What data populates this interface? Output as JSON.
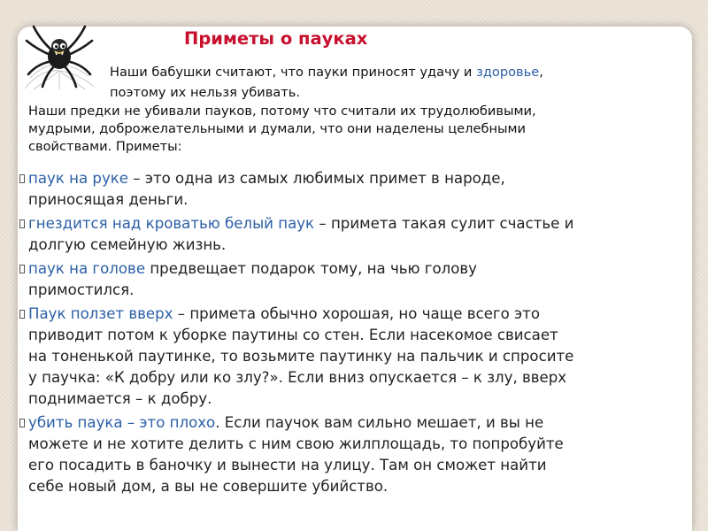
{
  "slide": {
    "title": "Приметы о пауках",
    "intro_lines": [
      {
        "plain": "Наши бабушки считают, что пауки приносят удачу и ",
        "highlight": "здоровье",
        "rest": ","
      },
      {
        "plain": "поэтому их нельзя убивать."
      }
    ],
    "paragraph_lines": [
      "Наши предки не убивали пауков, потому что считали их трудолюбивыми,",
      "мудрыми, доброжелательными и думали, что они наделены целебными",
      "свойствами. Приметы:"
    ],
    "bullets": [
      {
        "lines": [
          {
            "highlight": "паук на руке",
            "rest": " – это одна из самых любимых примет в народе,"
          },
          {
            "rest": "приносящая деньги."
          }
        ]
      },
      {
        "lines": [
          {
            "highlight": "гнездится над кроватью белый паук",
            "rest": " – примета такая сулит счастье и"
          },
          {
            "rest": "долгую семейную жизнь."
          }
        ]
      },
      {
        "lines": [
          {
            "highlight": " паук на голове",
            "rest": " предвещает подарок тому, на чью голову"
          },
          {
            "rest": "примостился."
          }
        ]
      },
      {
        "lines": [
          {
            "highlight": "Паук ползет вверх",
            "rest": " – примета обычно хорошая, но чаще всего это"
          },
          {
            "rest": "приводит потом к уборке паутины со стен. Если насекомое свисает"
          },
          {
            "rest": "на тоненькой паутинке, то возьмите паутинку на пальчик и спросите"
          },
          {
            "rest": "у паучка: «К добру или ко злу?». Если вниз опускается – к злу, вверх"
          },
          {
            "rest": "поднимается – к добру."
          }
        ]
      },
      {
        "lines": [
          {
            "highlight": " убить паука – это плохо",
            "rest": ". Если паучок вам сильно мешает, и вы не"
          },
          {
            "rest": "можете и не хотите делить с ним свою жилплощадь, то попробуйте"
          },
          {
            "rest": "его посадить в баночку и вынести на улицу. Там он сможет найти"
          },
          {
            "rest": "себе новый дом, а вы не совершите убийство."
          }
        ]
      }
    ],
    "colors": {
      "title": "#c8102e",
      "highlight": "#2b5fa6",
      "text": "#222222",
      "background": "#ece3d7",
      "card": "#ffffff"
    },
    "icons": {
      "illustration": "spider-icon",
      "bullet": "bullet-icon"
    }
  }
}
